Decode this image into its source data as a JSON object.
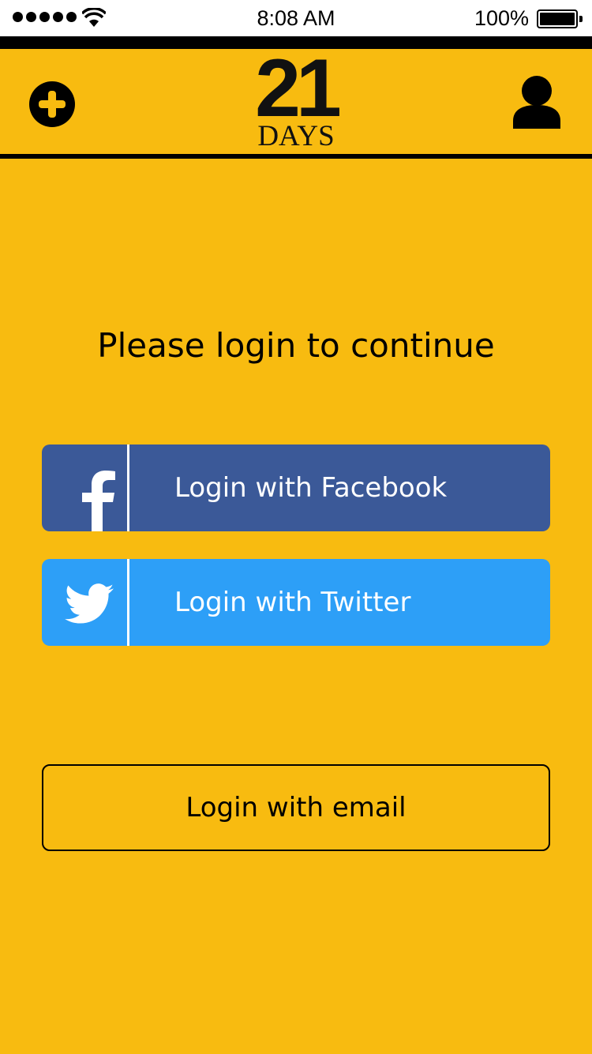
{
  "status_bar": {
    "time": "8:08 AM",
    "battery_percent": "100%",
    "signal_icon": "signal-dots-icon",
    "wifi_icon": "wifi-icon",
    "battery_icon": "battery-icon"
  },
  "nav": {
    "logo_number": "21",
    "logo_word": "DAYS",
    "left_icon": "plus-circle-icon",
    "right_icon": "user-profile-icon"
  },
  "content": {
    "prompt": "Please login to continue",
    "facebook_label": "Login with Facebook",
    "twitter_label": "Login with Twitter",
    "email_label": "Login with email"
  },
  "colors": {
    "background": "#F8BB10",
    "facebook": "#3B5998",
    "twitter": "#2D9FF7",
    "text": "#000000"
  }
}
